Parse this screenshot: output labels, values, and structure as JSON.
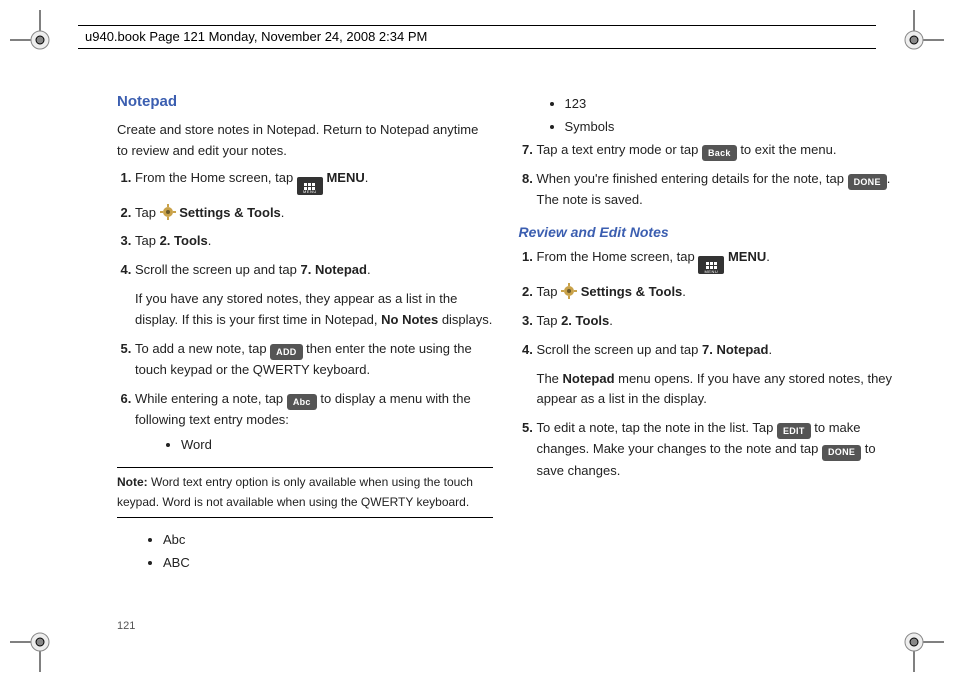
{
  "header": {
    "running_head": "u940.book  Page 121  Monday, November 24, 2008  2:34 PM"
  },
  "page_number": "121",
  "left": {
    "heading": "Notepad",
    "intro": "Create and store notes in Notepad. Return to Notepad anytime to review and edit your notes.",
    "step1_a": "From the Home screen, tap ",
    "step1_b": " MENU",
    "step1_c": ".",
    "step2_a": "Tap ",
    "step2_b": " Settings & Tools",
    "step2_c": ".",
    "step3_a": "Tap ",
    "step3_b": "2. Tools",
    "step3_c": ".",
    "step4_a": "Scroll the screen up and tap ",
    "step4_b": "7. Notepad",
    "step4_c": ".",
    "step4_p2a": "If you have any stored notes, they appear as a list in the display. If this is your first time in Notepad, ",
    "step4_p2b": "No Notes",
    "step4_p2c": " displays.",
    "step5_a": "To add a new note, tap ",
    "step5_b": " then enter the note using the touch keypad or the QWERTY keyboard.",
    "btn_add": "ADD",
    "step6_a": "While entering a note, tap ",
    "step6_b": " to display a menu with the following text entry modes:",
    "btn_abc": "Abc",
    "mode_word": "Word",
    "note_label": "Note:",
    "note_text": "  Word text entry option is only available when using the touch keypad. Word is not available when using the QWERTY keyboard.",
    "mode_Abc": "Abc",
    "mode_ABC": "ABC"
  },
  "right": {
    "mode_123": "123",
    "mode_symbols": "Symbols",
    "step7_a": "Tap a text entry mode or tap ",
    "step7_b": " to exit the menu.",
    "btn_back": "Back",
    "step8_a": "When you're finished entering details for the note, tap ",
    "step8_b": ". The note is saved.",
    "btn_done": "DONE",
    "heading2": "Review and Edit Notes",
    "r_step1_a": "From the Home screen, tap ",
    "r_step1_b": " MENU",
    "r_step1_c": ".",
    "r_step2_a": "Tap ",
    "r_step2_b": " Settings & Tools",
    "r_step2_c": ".",
    "r_step3_a": "Tap ",
    "r_step3_b": "2. Tools",
    "r_step3_c": ".",
    "r_step4_a": "Scroll the screen up and tap ",
    "r_step4_b": "7. Notepad",
    "r_step4_c": ".",
    "r_step4_p2a": "The ",
    "r_step4_p2b": "Notepad",
    "r_step4_p2c": " menu opens. If you have any stored notes, they appear as a list in the display.",
    "r_step5_a": "To edit a note, tap the note in the list. Tap ",
    "r_step5_b": " to make changes. Make your changes to the note and tap ",
    "r_step5_c": " to save changes.",
    "btn_edit": "EDIT",
    "btn_done2": "DONE"
  }
}
